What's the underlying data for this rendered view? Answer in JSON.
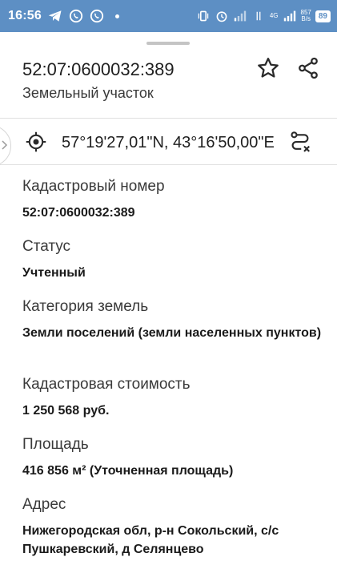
{
  "status_bar": {
    "time": "16:56",
    "net_top": "4G",
    "speed_top": "857",
    "speed_bottom": "B/s",
    "battery": "89"
  },
  "header": {
    "title": "52:07:0600032:389",
    "subtitle": "Земельный участок"
  },
  "location": {
    "coordinates": "57°19'27,01\"N, 43°16'50,00\"E"
  },
  "fields": [
    {
      "label": "Кадастровый номер",
      "value": "52:07:0600032:389"
    },
    {
      "label": "Статус",
      "value": "Учтенный"
    },
    {
      "label": "Категория земель",
      "value": "Земли поселений (земли населенных пунктов)"
    },
    {
      "label": "Кадастровая стоимость",
      "value": "1 250 568 руб."
    },
    {
      "label": "Площадь",
      "value": "416 856 м² (Уточненная площадь)"
    },
    {
      "label": "Адрес",
      "value": "Нижегородская обл, р-н Сокольский, с/с Пушкаревский, д Селянцево"
    }
  ],
  "icons": {
    "star": "star-icon",
    "share": "share-icon",
    "locate": "crosshair-icon",
    "route": "route-clear-icon"
  },
  "colors": {
    "status_bar": "#5d8fc4",
    "text": "#1f1f1f"
  }
}
